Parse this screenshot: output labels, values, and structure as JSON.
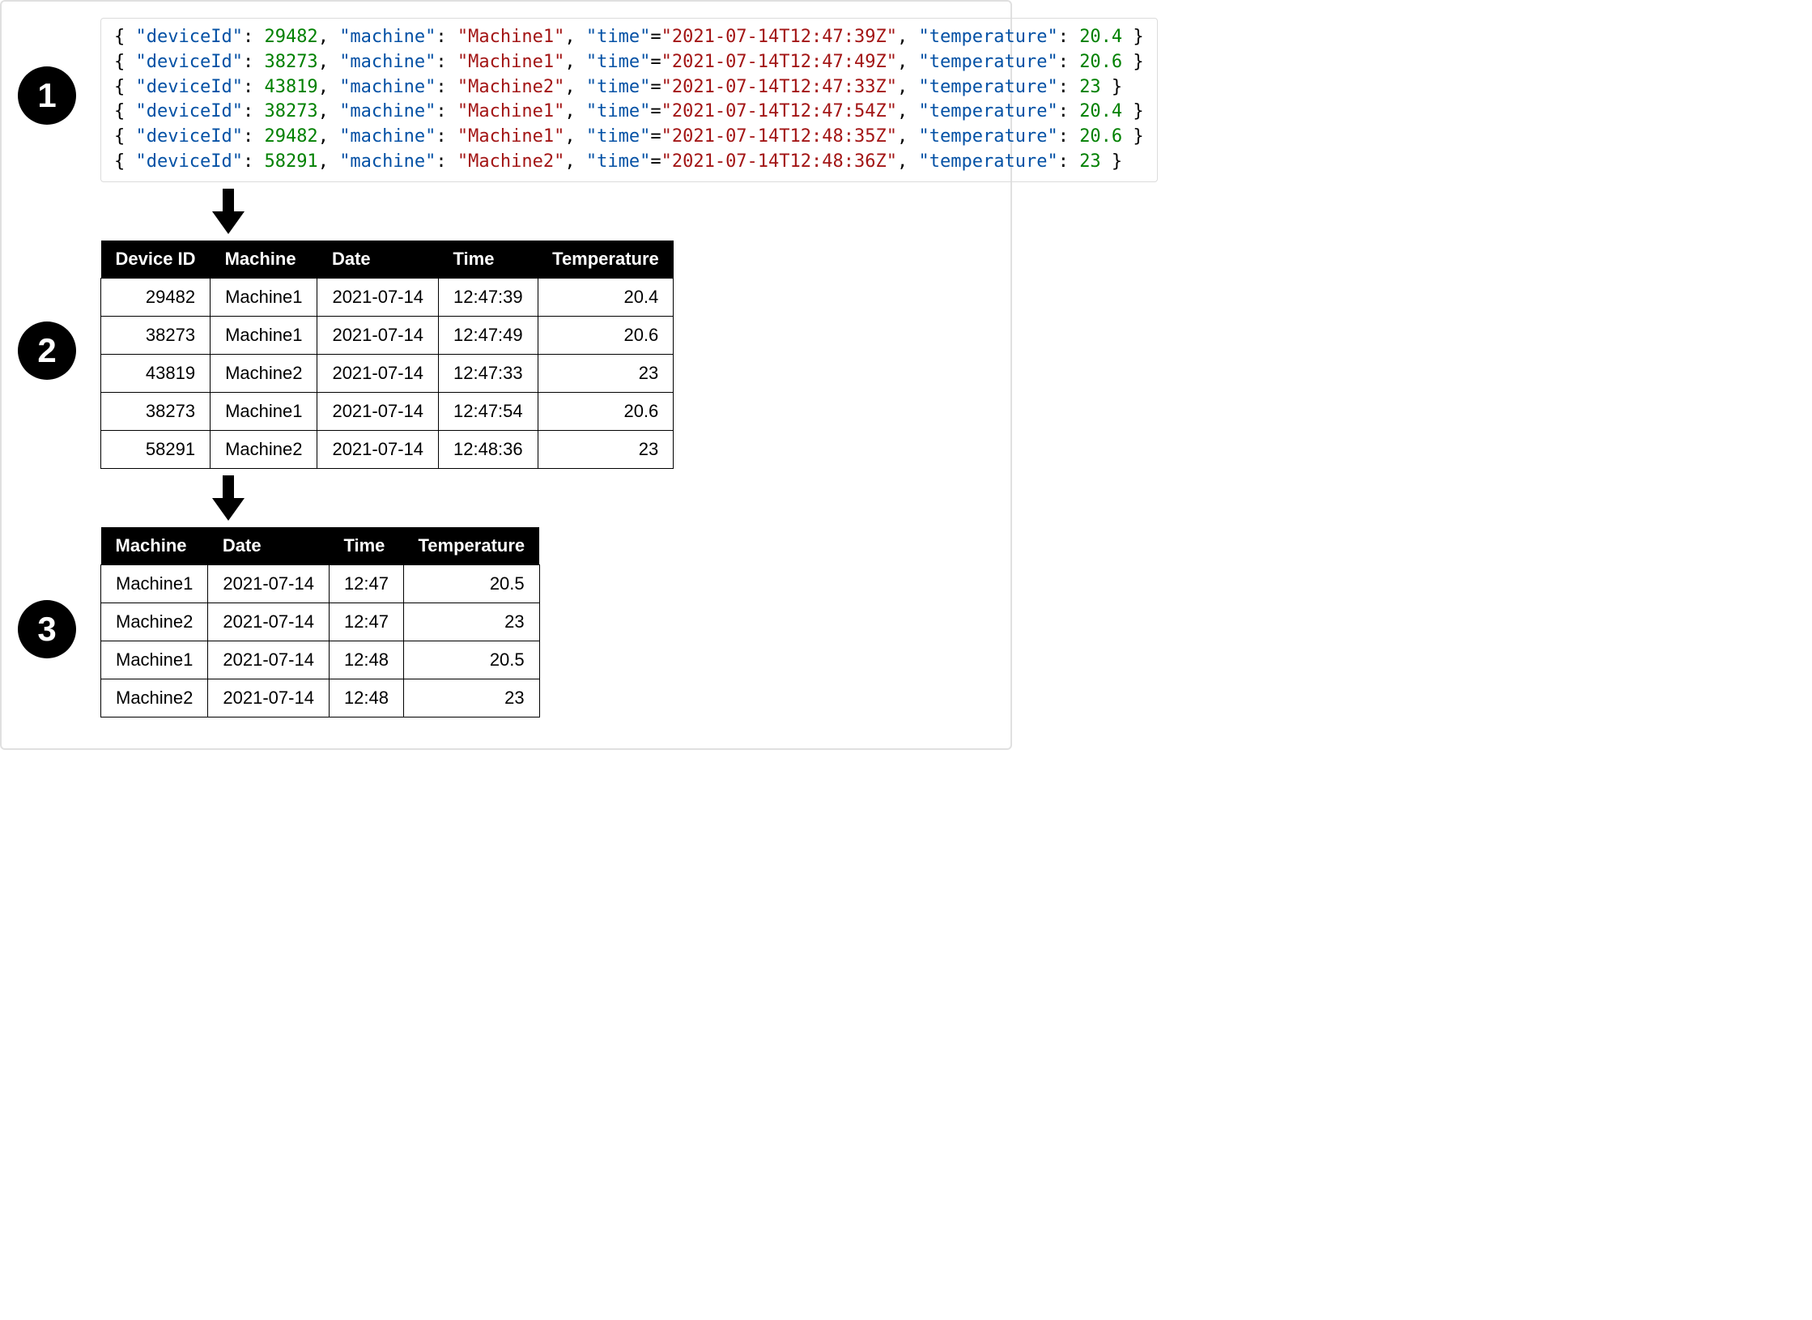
{
  "steps": {
    "one": "1",
    "two": "2",
    "three": "3"
  },
  "json": {
    "key_deviceId": "\"deviceId\"",
    "key_machine": "\"machine\"",
    "key_time": "\"time\"",
    "key_temperature": "\"temperature\"",
    "rows": [
      {
        "deviceId": "29482",
        "machine": "\"Machine1\"",
        "time": "\"2021-07-14T12:47:39Z\"",
        "temperature": "20.4"
      },
      {
        "deviceId": "38273",
        "machine": "\"Machine1\"",
        "time": "\"2021-07-14T12:47:49Z\"",
        "temperature": "20.6"
      },
      {
        "deviceId": "43819",
        "machine": "\"Machine2\"",
        "time": "\"2021-07-14T12:47:33Z\"",
        "temperature": "23"
      },
      {
        "deviceId": "38273",
        "machine": "\"Machine1\"",
        "time": "\"2021-07-14T12:47:54Z\"",
        "temperature": "20.4"
      },
      {
        "deviceId": "29482",
        "machine": "\"Machine1\"",
        "time": "\"2021-07-14T12:48:35Z\"",
        "temperature": "20.6"
      },
      {
        "deviceId": "58291",
        "machine": "\"Machine2\"",
        "time": "\"2021-07-14T12:48:36Z\"",
        "temperature": "23"
      }
    ]
  },
  "table_raw": {
    "headers": {
      "deviceId": "Device ID",
      "machine": "Machine",
      "date": "Date",
      "time": "Time",
      "temperature": "Temperature"
    },
    "rows": [
      {
        "deviceId": "29482",
        "machine": "Machine1",
        "date": "2021-07-14",
        "time": "12:47:39",
        "temperature": "20.4"
      },
      {
        "deviceId": "38273",
        "machine": "Machine1",
        "date": "2021-07-14",
        "time": "12:47:49",
        "temperature": "20.6"
      },
      {
        "deviceId": "43819",
        "machine": "Machine2",
        "date": "2021-07-14",
        "time": "12:47:33",
        "temperature": "23"
      },
      {
        "deviceId": "38273",
        "machine": "Machine1",
        "date": "2021-07-14",
        "time": "12:47:54",
        "temperature": "20.6"
      },
      {
        "deviceId": "58291",
        "machine": "Machine2",
        "date": "2021-07-14",
        "time": "12:48:36",
        "temperature": "23"
      }
    ]
  },
  "table_agg": {
    "headers": {
      "machine": "Machine",
      "date": "Date",
      "time": "Time",
      "temperature": "Temperature"
    },
    "rows": [
      {
        "machine": "Machine1",
        "date": "2021-07-14",
        "time": "12:47",
        "temperature": "20.5"
      },
      {
        "machine": "Machine2",
        "date": "2021-07-14",
        "time": "12:47",
        "temperature": "23"
      },
      {
        "machine": "Machine1",
        "date": "2021-07-14",
        "time": "12:48",
        "temperature": "20.5"
      },
      {
        "machine": "Machine2",
        "date": "2021-07-14",
        "time": "12:48",
        "temperature": "23"
      }
    ]
  }
}
